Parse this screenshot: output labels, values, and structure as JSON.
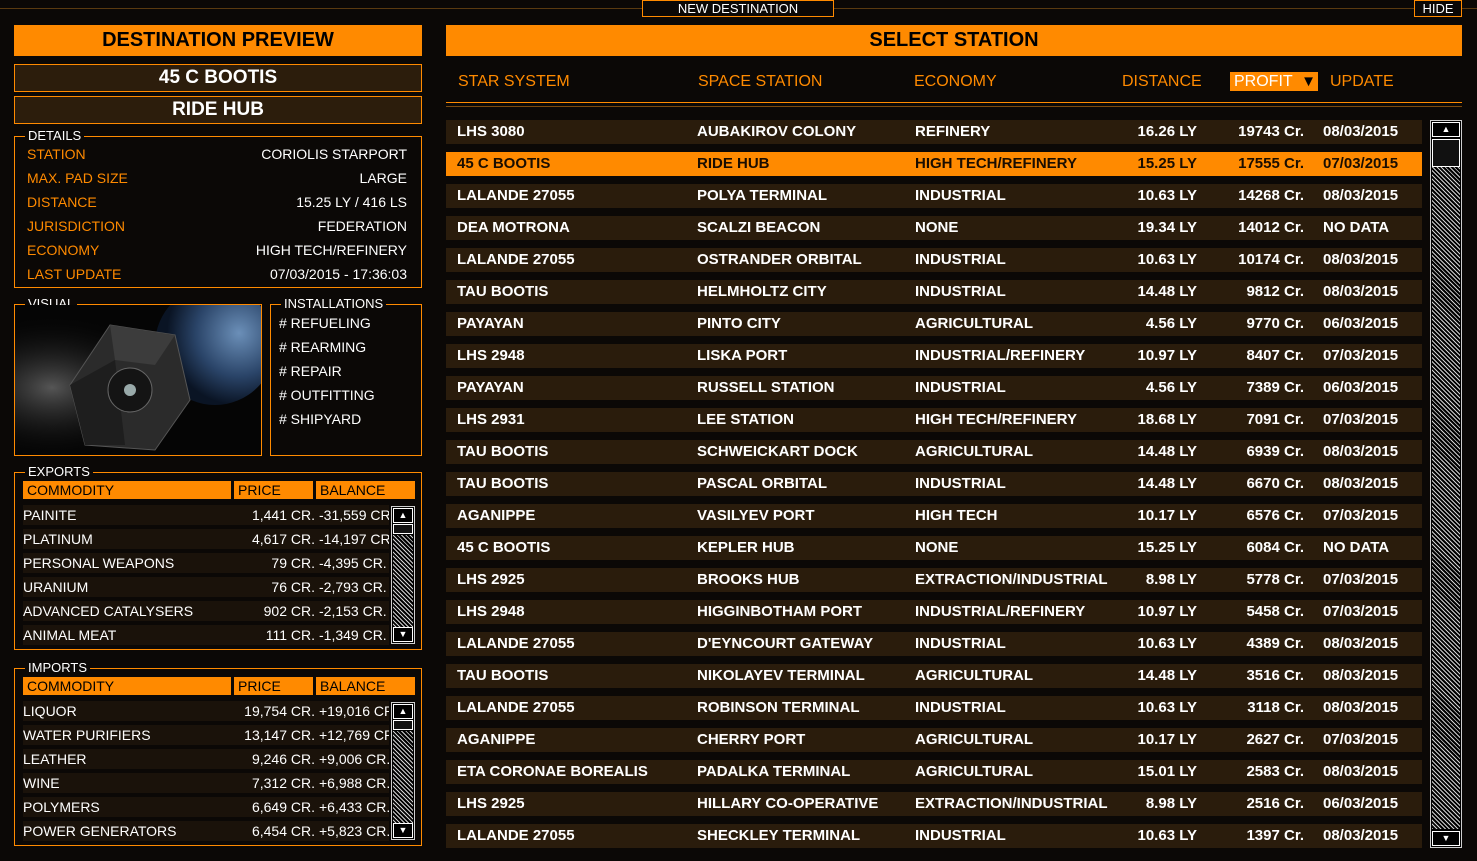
{
  "topbar": {
    "new_destination": "NEW DESTINATION",
    "hide": "HIDE"
  },
  "preview": {
    "header": "DESTINATION PREVIEW",
    "system": "45 C BOOTIS",
    "station": "RIDE HUB",
    "details_title": "DETAILS",
    "details": [
      {
        "label": "STATION",
        "value": "CORIOLIS STARPORT"
      },
      {
        "label": "MAX. PAD SIZE",
        "value": "LARGE"
      },
      {
        "label": "DISTANCE",
        "value": "15.25 LY / 416 LS"
      },
      {
        "label": "JURISDICTION",
        "value": "FEDERATION"
      },
      {
        "label": "ECONOMY",
        "value": "HIGH TECH/REFINERY"
      },
      {
        "label": "LAST UPDATE",
        "value": "07/03/2015 - 17:36:03"
      }
    ],
    "visual_title": "VISUAL",
    "installations_title": "INSTALLATIONS",
    "installations": [
      "# REFUELING",
      "# REARMING",
      "# REPAIR",
      "# OUTFITTING",
      "# SHIPYARD"
    ]
  },
  "exports": {
    "title": "EXPORTS",
    "headers": {
      "commodity": "COMMODITY",
      "price": "PRICE",
      "balance": "BALANCE"
    },
    "rows": [
      {
        "name": "PAINITE",
        "price": "1,441 CR.",
        "balance": "-31,559 CR."
      },
      {
        "name": "PLATINUM",
        "price": "4,617 CR.",
        "balance": "-14,197 CR."
      },
      {
        "name": "PERSONAL WEAPONS",
        "price": "79 CR.",
        "balance": "-4,395 CR."
      },
      {
        "name": "URANIUM",
        "price": "76 CR.",
        "balance": "-2,793 CR."
      },
      {
        "name": "ADVANCED CATALYSERS",
        "price": "902 CR.",
        "balance": "-2,153 CR."
      },
      {
        "name": "ANIMAL MEAT",
        "price": "111 CR.",
        "balance": "-1,349 CR."
      }
    ]
  },
  "imports": {
    "title": "IMPORTS",
    "headers": {
      "commodity": "COMMODITY",
      "price": "PRICE",
      "balance": "BALANCE"
    },
    "rows": [
      {
        "name": "LIQUOR",
        "price": "19,754 CR.",
        "balance": "+19,016 CR."
      },
      {
        "name": "WATER PURIFIERS",
        "price": "13,147 CR.",
        "balance": "+12,769 CR."
      },
      {
        "name": "LEATHER",
        "price": "9,246 CR.",
        "balance": "+9,006 CR."
      },
      {
        "name": "WINE",
        "price": "7,312 CR.",
        "balance": "+6,988 CR."
      },
      {
        "name": "POLYMERS",
        "price": "6,649 CR.",
        "balance": "+6,433 CR."
      },
      {
        "name": "POWER GENERATORS",
        "price": "6,454 CR.",
        "balance": "+5,823 CR."
      }
    ]
  },
  "select": {
    "header": "SELECT STATION",
    "columns": {
      "system": "STAR SYSTEM",
      "station": "SPACE STATION",
      "economy": "ECONOMY",
      "distance": "DISTANCE",
      "profit": "PROFIT",
      "update": "UPDATE"
    },
    "selected_index": 1,
    "rows": [
      {
        "system": "LHS 3080",
        "station": "AUBAKIROV COLONY",
        "economy": "REFINERY",
        "distance": "16.26 LY",
        "profit": "19743 Cr.",
        "update": "08/03/2015"
      },
      {
        "system": "45 C BOOTIS",
        "station": "RIDE HUB",
        "economy": "HIGH TECH/REFINERY",
        "distance": "15.25 LY",
        "profit": "17555 Cr.",
        "update": "07/03/2015"
      },
      {
        "system": "LALANDE 27055",
        "station": "POLYA TERMINAL",
        "economy": "INDUSTRIAL",
        "distance": "10.63 LY",
        "profit": "14268 Cr.",
        "update": "08/03/2015"
      },
      {
        "system": "DEA MOTRONA",
        "station": "SCALZI BEACON",
        "economy": "NONE",
        "distance": "19.34 LY",
        "profit": "14012 Cr.",
        "update": "NO DATA"
      },
      {
        "system": "LALANDE 27055",
        "station": "OSTRANDER ORBITAL",
        "economy": "INDUSTRIAL",
        "distance": "10.63 LY",
        "profit": "10174 Cr.",
        "update": "08/03/2015"
      },
      {
        "system": "TAU BOOTIS",
        "station": "HELMHOLTZ CITY",
        "economy": "INDUSTRIAL",
        "distance": "14.48 LY",
        "profit": "9812 Cr.",
        "update": "08/03/2015"
      },
      {
        "system": "PAYAYAN",
        "station": "PINTO CITY",
        "economy": "AGRICULTURAL",
        "distance": "4.56 LY",
        "profit": "9770 Cr.",
        "update": "06/03/2015"
      },
      {
        "system": "LHS 2948",
        "station": "LISKA PORT",
        "economy": "INDUSTRIAL/REFINERY",
        "distance": "10.97 LY",
        "profit": "8407 Cr.",
        "update": "07/03/2015"
      },
      {
        "system": "PAYAYAN",
        "station": "RUSSELL STATION",
        "economy": "INDUSTRIAL",
        "distance": "4.56 LY",
        "profit": "7389 Cr.",
        "update": "06/03/2015"
      },
      {
        "system": "LHS 2931",
        "station": "LEE STATION",
        "economy": "HIGH TECH/REFINERY",
        "distance": "18.68 LY",
        "profit": "7091 Cr.",
        "update": "07/03/2015"
      },
      {
        "system": "TAU BOOTIS",
        "station": "SCHWEICKART DOCK",
        "economy": "AGRICULTURAL",
        "distance": "14.48 LY",
        "profit": "6939 Cr.",
        "update": "08/03/2015"
      },
      {
        "system": "TAU BOOTIS",
        "station": "PASCAL ORBITAL",
        "economy": "INDUSTRIAL",
        "distance": "14.48 LY",
        "profit": "6670 Cr.",
        "update": "08/03/2015"
      },
      {
        "system": "AGANIPPE",
        "station": "VASILYEV PORT",
        "economy": "HIGH TECH",
        "distance": "10.17 LY",
        "profit": "6576 Cr.",
        "update": "07/03/2015"
      },
      {
        "system": "45 C BOOTIS",
        "station": "KEPLER HUB",
        "economy": "NONE",
        "distance": "15.25 LY",
        "profit": "6084 Cr.",
        "update": "NO DATA"
      },
      {
        "system": "LHS 2925",
        "station": "BROOKS HUB",
        "economy": "EXTRACTION/INDUSTRIAL",
        "distance": "8.98 LY",
        "profit": "5778 Cr.",
        "update": "07/03/2015"
      },
      {
        "system": "LHS 2948",
        "station": "HIGGINBOTHAM PORT",
        "economy": "INDUSTRIAL/REFINERY",
        "distance": "10.97 LY",
        "profit": "5458 Cr.",
        "update": "07/03/2015"
      },
      {
        "system": "LALANDE 27055",
        "station": "D'EYNCOURT GATEWAY",
        "economy": "INDUSTRIAL",
        "distance": "10.63 LY",
        "profit": "4389 Cr.",
        "update": "08/03/2015"
      },
      {
        "system": "TAU BOOTIS",
        "station": "NIKOLAYEV TERMINAL",
        "economy": "AGRICULTURAL",
        "distance": "14.48 LY",
        "profit": "3516 Cr.",
        "update": "08/03/2015"
      },
      {
        "system": "LALANDE 27055",
        "station": "ROBINSON TERMINAL",
        "economy": "INDUSTRIAL",
        "distance": "10.63 LY",
        "profit": "3118 Cr.",
        "update": "08/03/2015"
      },
      {
        "system": "AGANIPPE",
        "station": "CHERRY PORT",
        "economy": "AGRICULTURAL",
        "distance": "10.17 LY",
        "profit": "2627 Cr.",
        "update": "07/03/2015"
      },
      {
        "system": "ETA CORONAE BOREALIS",
        "station": "PADALKA TERMINAL",
        "economy": "AGRICULTURAL",
        "distance": "15.01 LY",
        "profit": "2583 Cr.",
        "update": "08/03/2015"
      },
      {
        "system": "LHS 2925",
        "station": "HILLARY CO-OPERATIVE",
        "economy": "EXTRACTION/INDUSTRIAL",
        "distance": "8.98 LY",
        "profit": "2516 Cr.",
        "update": "06/03/2015"
      },
      {
        "system": "LALANDE 27055",
        "station": "SHECKLEY TERMINAL",
        "economy": "INDUSTRIAL",
        "distance": "10.63 LY",
        "profit": "1397 Cr.",
        "update": "08/03/2015"
      }
    ]
  },
  "icons": {
    "scroll_up": "▲",
    "scroll_down": "▼",
    "sort_desc": "▼"
  },
  "colors": {
    "accent": "#ff8a00",
    "row_bg": "#2a1c0c",
    "background": "#0b0806"
  }
}
